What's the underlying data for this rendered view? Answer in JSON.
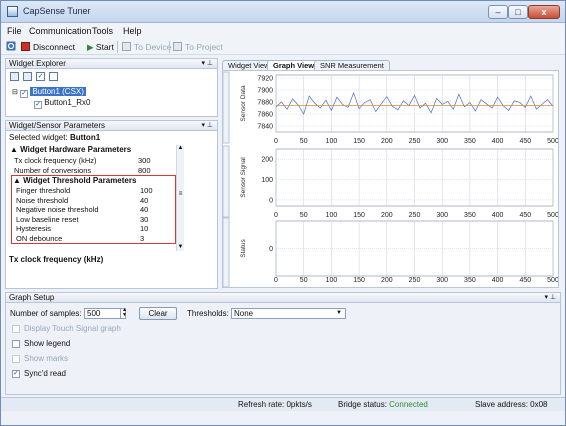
{
  "window": {
    "title": "CapSense Tuner",
    "minimize": "–",
    "maximize": "□",
    "close": "x"
  },
  "menu": [
    "File",
    "Communication",
    "Tools",
    "Help"
  ],
  "toolbar": {
    "disconnect": "Disconnect",
    "start": "Start",
    "to_device": "To Device",
    "to_project": "To Project"
  },
  "widget_explorer": {
    "title": "Widget Explorer",
    "tree": [
      {
        "label": "Button1 (CSX)",
        "checked": true,
        "selected": true
      },
      {
        "label": "Button1_Rx0",
        "checked": true,
        "selected": false
      }
    ]
  },
  "params": {
    "title": "Widget/Sensor Parameters",
    "selected_label": "Selected widget:",
    "selected_widget": "Button1",
    "hw_group": "Widget Hardware Parameters",
    "hw_rows": [
      {
        "name": "Tx clock frequency (kHz)",
        "value": "300"
      },
      {
        "name": "Number of conversions",
        "value": "800"
      }
    ],
    "thr_group": "Widget Threshold Parameters",
    "thr_rows": [
      {
        "name": "Finger threshold",
        "value": "100"
      },
      {
        "name": "Noise threshold",
        "value": "40"
      },
      {
        "name": "Negative noise threshold",
        "value": "40"
      },
      {
        "name": "Low baseline reset",
        "value": "30"
      },
      {
        "name": "Hysteresis",
        "value": "10"
      },
      {
        "name": "ON debounce",
        "value": "3"
      }
    ],
    "description_title": "Tx clock frequency (kHz)"
  },
  "tabs": [
    "Widget View",
    "Graph View",
    "SNR Measurement"
  ],
  "chart_data": [
    {
      "type": "line",
      "ylabel": "Sensor Data",
      "xlim": [
        0,
        500
      ],
      "ylim": [
        7830,
        7925
      ],
      "x_ticks": [
        0,
        50,
        100,
        150,
        200,
        250,
        300,
        350,
        400,
        450,
        500
      ],
      "y_ticks": [
        7840,
        7860,
        7880,
        7900,
        7920
      ],
      "series": [
        {
          "values": [
            7872,
            7880,
            7868,
            7885,
            7875,
            7860,
            7890,
            7878,
            7870,
            7883,
            7866,
            7888,
            7876,
            7871,
            7895,
            7869,
            7879,
            7884,
            7864,
            7877,
            7889,
            7873,
            7867,
            7882,
            7874,
            7891,
            7870,
            7878,
            7862,
            7886,
            7876,
            7881,
            7868,
            7893,
            7872,
            7879,
            7865,
            7884,
            7877,
            7870,
            7888,
            7874,
            7866,
            7882,
            7879,
            7871,
            7890,
            7868,
            7876,
            7884,
            7873
          ]
        },
        {
          "values": [
            7874,
            7874,
            7874,
            7874,
            7874,
            7874,
            7874,
            7874,
            7874,
            7874,
            7874,
            7874,
            7874,
            7874,
            7874,
            7874,
            7874,
            7874,
            7874,
            7874,
            7874,
            7874,
            7874,
            7874,
            7874,
            7874,
            7874,
            7874,
            7874,
            7874,
            7874,
            7874,
            7874,
            7874,
            7874,
            7874,
            7874,
            7874,
            7874,
            7874,
            7874,
            7874,
            7874,
            7874,
            7874,
            7874,
            7874,
            7874,
            7874,
            7874,
            7874
          ]
        }
      ]
    },
    {
      "type": "line",
      "ylabel": "Sensor Signal",
      "xlim": [
        0,
        500
      ],
      "ylim": [
        -30,
        250
      ],
      "x_ticks": [
        0,
        50,
        100,
        150,
        200,
        250,
        300,
        350,
        400,
        450,
        500
      ],
      "y_ticks": [
        0,
        100,
        200
      ],
      "series": []
    },
    {
      "type": "line",
      "ylabel": "Status",
      "xlim": [
        0,
        500
      ],
      "ylim": [
        -1,
        1
      ],
      "x_ticks": [
        0,
        50,
        100,
        150,
        200,
        250,
        300,
        350,
        400,
        450,
        500
      ],
      "y_ticks": [
        0
      ],
      "series": []
    }
  ],
  "graph_setup": {
    "title": "Graph Setup",
    "samples_label": "Number of samples:",
    "samples_value": "500",
    "clear": "Clear",
    "thresholds_label": "Thresholds:",
    "thresholds_value": "None",
    "display_touch": "Display Touch Signal graph",
    "show_legend": "Show legend",
    "show_marks": "Show marks",
    "syncd_read": "Sync'd read"
  },
  "status": {
    "refresh_label": "Refresh rate:",
    "refresh_value": "0pkts/s",
    "bridge_label": "Bridge status:",
    "bridge_value": "Connected",
    "slave_label": "Slave address:",
    "slave_value": "0x08"
  },
  "colors": {
    "series_line": "#4a6fd0",
    "baseline": "#d98a3a",
    "connected": "#2e8b2e",
    "highlight_box": "#d23a3a"
  }
}
